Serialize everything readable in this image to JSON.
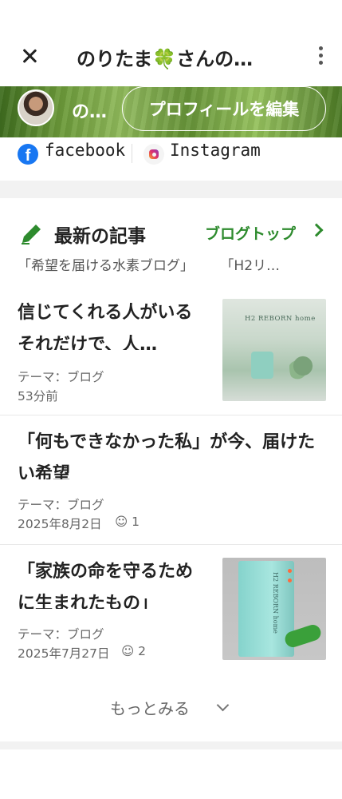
{
  "header": {
    "title": "のりたま🍀さんの…"
  },
  "profile": {
    "name": "の…",
    "edit_button": "プロフィールを編集"
  },
  "social": {
    "facebook": "facebook",
    "instagram": "Instagram"
  },
  "latest": {
    "title": "最新の記事",
    "blog_top_link": "ブログトップ",
    "themes": [
      "「希望を届ける水素ブログ」",
      "「H2リ…"
    ]
  },
  "articles": [
    {
      "title": "信じてくれる人がいるそれだけで、人…",
      "theme": "テーマ：ブログ",
      "time": "53分前",
      "likes": ""
    },
    {
      "title": "「何もできなかった私」が今、届けたい希望",
      "theme": "テーマ：ブログ",
      "time": "2025年8月2日",
      "likes": "1"
    },
    {
      "title": "「家族の命を守るために生まれたもの」",
      "theme": "テーマ：ブログ",
      "time": "2025年7月27日",
      "likes": "2"
    }
  ],
  "thumbnails": {
    "article1": "H2 REBORN home",
    "article3": "H2 REBORN home"
  },
  "more": {
    "label": "もっとみる"
  },
  "colors": {
    "accent_green": "#2e8b2e",
    "facebook_blue": "#1877f2"
  }
}
